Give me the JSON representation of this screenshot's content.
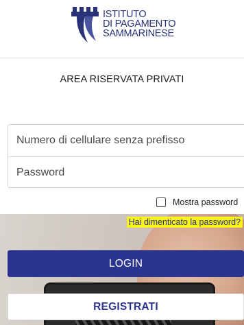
{
  "header": {
    "logo_lines": [
      "ISTITUTO",
      "DI PAGAMENTO",
      "SAMMARINESE"
    ]
  },
  "page": {
    "area_title": "AREA RISERVATA PRIVATI"
  },
  "form": {
    "phone_placeholder": "Numero di cellulare senza prefisso",
    "phone_value": "",
    "password_placeholder": "Password",
    "password_value": "",
    "show_password_label": "Mostra password",
    "show_password_checked": false,
    "forgot_password_link": "Hai dimenticato la password?"
  },
  "buttons": {
    "login_label": "LOGIN",
    "register_label": "REGISTRATI"
  },
  "colors": {
    "brand_blue": "#2b3490",
    "highlight_yellow": "#f7f21a"
  }
}
